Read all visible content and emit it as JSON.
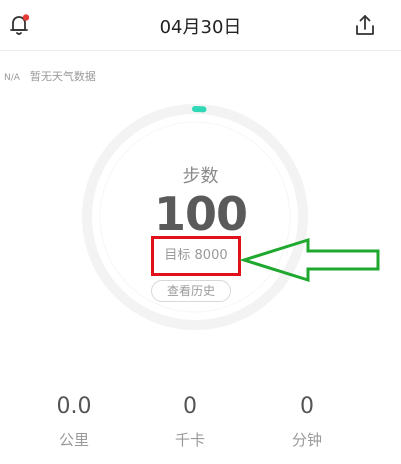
{
  "header": {
    "date": "04月30日",
    "bell_icon": "bell-icon",
    "share_icon": "share-icon",
    "notification_dot_color": "#e53935"
  },
  "weather": {
    "na": "N/A",
    "text": "暂无天气数据"
  },
  "steps": {
    "label": "步数",
    "value": "100",
    "goal_text": "目标 8000",
    "progress": 0.0125,
    "ring_accent_color": "#2ed8b6",
    "history_button": "查看历史"
  },
  "annotations": {
    "highlight_color": "#e0111a",
    "arrow_color": "#1fa82e"
  },
  "stats": [
    {
      "value": "0.0",
      "label": "公里"
    },
    {
      "value": "0",
      "label": "千卡"
    },
    {
      "value": "0",
      "label": "分钟"
    }
  ]
}
